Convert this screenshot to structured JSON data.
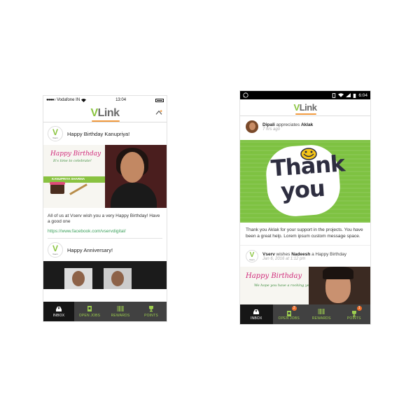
{
  "left_phone": {
    "status": {
      "carrier": "Vodafone IN",
      "time": "13:04"
    },
    "logo": {
      "v": "V",
      "rest": "Link"
    },
    "feed": [
      {
        "avatar_letter": "V",
        "avatar_caption": "Vserv",
        "title": "Happy Birthday Kanupriya!",
        "image": {
          "heading": "Happy Birthday",
          "tagline": "It's time to celebrate!",
          "name": "KANUPRIYA SHARMA"
        },
        "text": "All of us at Vserv wish you a very Happy Birthday! Have a good one",
        "link": "https://www.facebook.com/vservdigital/"
      },
      {
        "avatar_letter": "V",
        "avatar_caption": "Vserv",
        "title": "Happy Anniversary!"
      }
    ],
    "tabs": [
      "INBOX",
      "OPEN JOBS",
      "REWARDS",
      "POINTS"
    ]
  },
  "right_phone": {
    "status": {
      "time": "6:04"
    },
    "logo": {
      "v": "V",
      "rest": "Link"
    },
    "post1": {
      "from": "Dipali",
      "verb": "appreciates",
      "to": "Aklak",
      "time": "7 hrs ago",
      "sticker_line1": "Thank",
      "sticker_line2": "you",
      "text": "Thank you Aklak for your support in the projects. You have been a great help. Lorem ipsum custom message space."
    },
    "post2": {
      "avatar_letter": "V",
      "avatar_caption": "Vserv",
      "from": "Vserv",
      "verb": "wishes",
      "to": "Nadeesh",
      "suffix": "a Happy Birthday",
      "time": "Jan 6, 2016 at 1:12 pm",
      "image": {
        "heading": "Happy Birthday",
        "tagline": "We hope you have a rocking year ahead!"
      }
    },
    "tabs": [
      {
        "label": "INBOX"
      },
      {
        "label": "OPEN JOBS",
        "badge": "2"
      },
      {
        "label": "REWARDS"
      },
      {
        "label": "POINTS",
        "badge": "1"
      }
    ]
  },
  "colors": {
    "brand_green": "#8ac43f",
    "accent_orange": "#f19a3e",
    "tabbar": "#414141",
    "tab_active": "#161616",
    "tab_text": "#9dce4f"
  }
}
